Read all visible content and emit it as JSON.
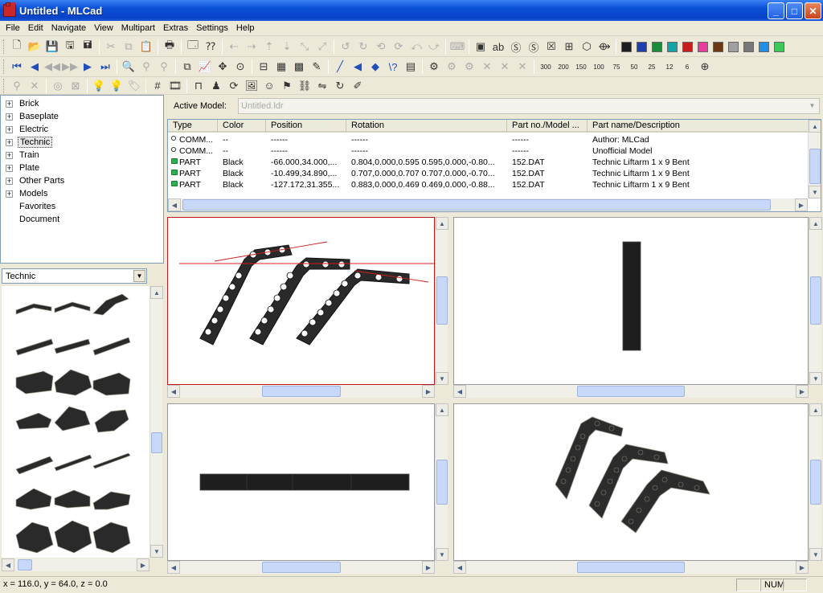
{
  "window": {
    "title": "Untitled - MLCad",
    "min": "_",
    "max": "□",
    "close": "✕"
  },
  "menu": [
    "File",
    "Edit",
    "Navigate",
    "View",
    "Multipart",
    "Extras",
    "Settings",
    "Help"
  ],
  "palette": [
    "#1e1e1e",
    "#1f3fb0",
    "#1e8a3c",
    "#12a5a5",
    "#c81e1e",
    "#e83c9c",
    "#6a3a14",
    "#a0a0a0",
    "#787878",
    "#1f8fe8",
    "#3cc85a"
  ],
  "tree": {
    "items": [
      {
        "label": "Brick",
        "expandable": true
      },
      {
        "label": "Baseplate",
        "expandable": true
      },
      {
        "label": "Electric",
        "expandable": true
      },
      {
        "label": "Technic",
        "expandable": true,
        "selected": true
      },
      {
        "label": "Train",
        "expandable": true
      },
      {
        "label": "Plate",
        "expandable": true
      },
      {
        "label": "Other Parts",
        "expandable": true
      },
      {
        "label": "Models",
        "expandable": true
      },
      {
        "label": "Favorites",
        "expandable": false
      },
      {
        "label": "Document",
        "expandable": false
      }
    ]
  },
  "category_select": {
    "value": "Technic"
  },
  "active_model": {
    "label": "Active Model:",
    "value": "Untitled.ldr"
  },
  "list": {
    "columns": [
      "Type",
      "Color",
      "Position",
      "Rotation",
      "Part no./Model ...",
      "Part name/Description"
    ],
    "rows": [
      {
        "icon": "pin",
        "type": "COMM...",
        "color": "--",
        "position": "------",
        "rotation": "------",
        "partno": "------",
        "desc": "Author: MLCad"
      },
      {
        "icon": "pin",
        "type": "COMM...",
        "color": "--",
        "position": "------",
        "rotation": "------",
        "partno": "------",
        "desc": "Unofficial Model"
      },
      {
        "icon": "part",
        "type": "PART",
        "color": "Black",
        "position": "-66.000,34.000,...",
        "rotation": "0.804,0.000,0.595 0.595,0.000,-0.80...",
        "partno": "152.DAT",
        "desc": "Technic Liftarm  1 x  9 Bent"
      },
      {
        "icon": "part",
        "type": "PART",
        "color": "Black",
        "position": "-10.499,34.890,...",
        "rotation": "0.707,0.000,0.707 0.707,0.000,-0.70...",
        "partno": "152.DAT",
        "desc": "Technic Liftarm  1 x  9 Bent"
      },
      {
        "icon": "part",
        "type": "PART",
        "color": "Black",
        "position": "-127.172,31.355...",
        "rotation": "0.883,0.000,0.469 0.469,0.000,-0.88...",
        "partno": "152.DAT",
        "desc": "Technic Liftarm  1 x  9 Bent"
      }
    ]
  },
  "zoom_labels": [
    "300",
    "200",
    "150",
    "100",
    "75",
    "50",
    "25",
    "12",
    "6"
  ],
  "status": {
    "coords": "x = 116.0, y = 64.0, z = 0.0",
    "num": "NUM"
  }
}
